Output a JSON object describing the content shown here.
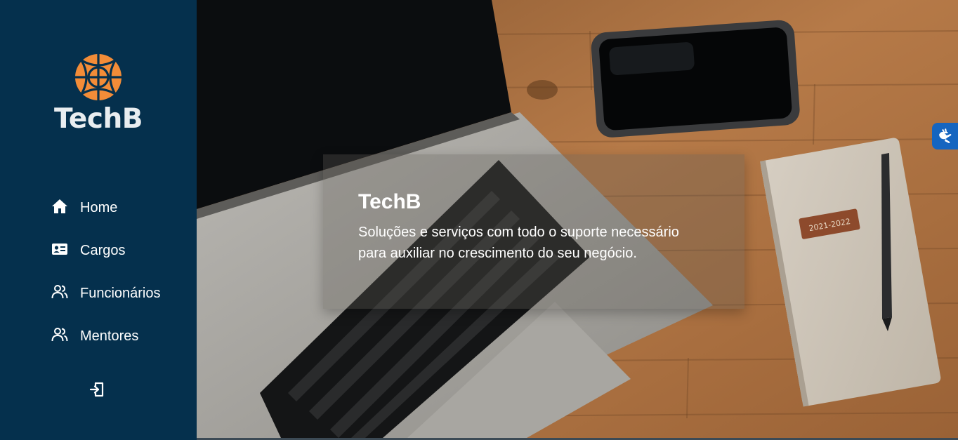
{
  "sidebar": {
    "logo_text": "TechB",
    "logo_color": "#f28c38",
    "background": "#05304d",
    "items": [
      {
        "label": "Home",
        "icon": "home-icon"
      },
      {
        "label": "Cargos",
        "icon": "id-card-icon"
      },
      {
        "label": "Funcionários",
        "icon": "people-icon"
      },
      {
        "label": "Mentores",
        "icon": "people-icon"
      }
    ],
    "logout_icon": "logout-icon"
  },
  "hero": {
    "title": "TechB",
    "subtitle": "Soluções e serviços com todo o suporte necessário para auxiliar no crescimento do seu negócio.",
    "notebook_stamp": "2021-2022"
  },
  "accessibility": {
    "icon": "sign-language-icon",
    "color": "#1565c0"
  }
}
